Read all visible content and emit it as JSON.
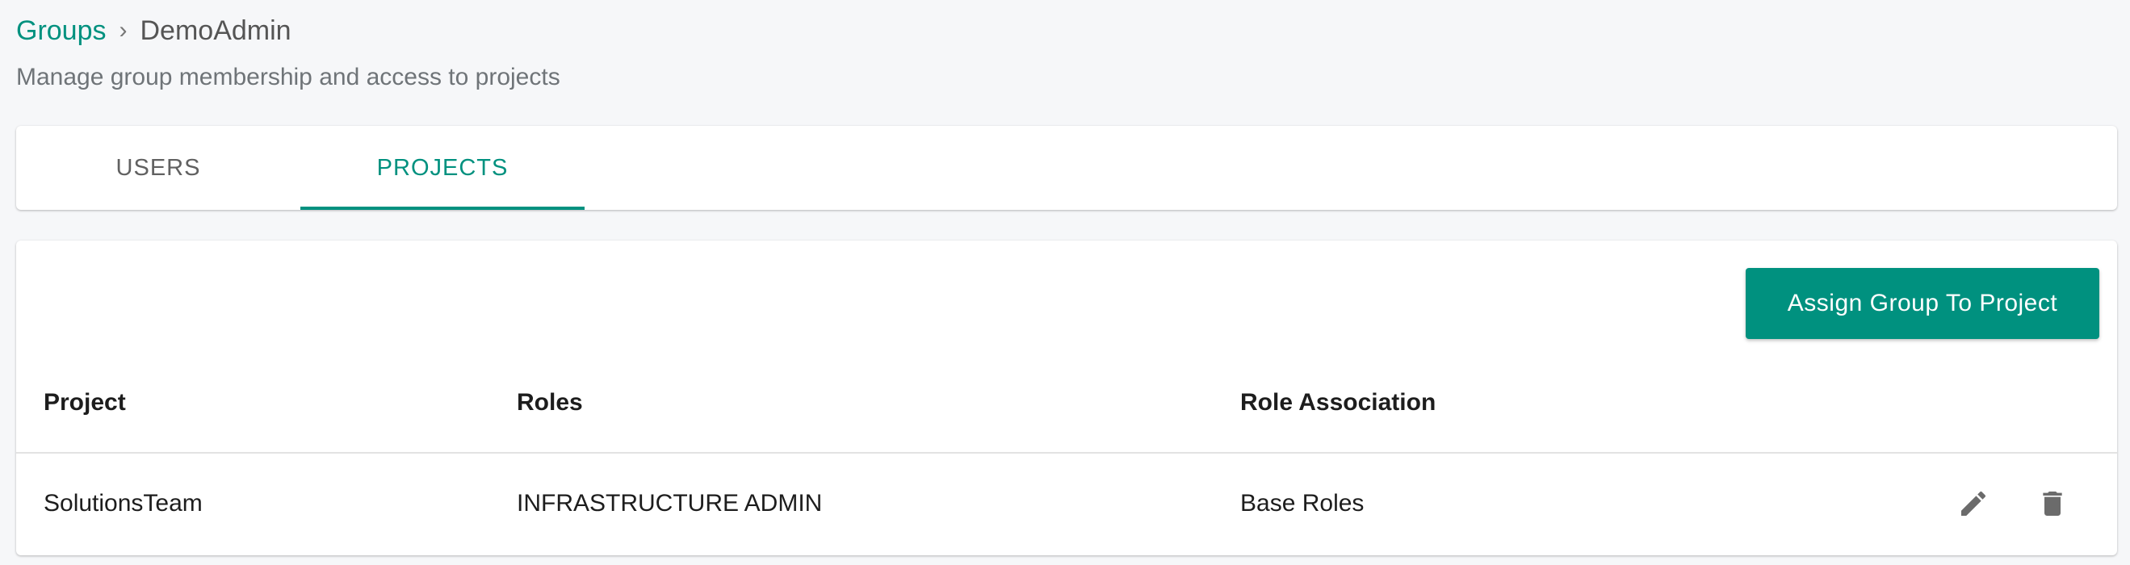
{
  "breadcrumb": {
    "parent": "Groups",
    "separator": "›",
    "current": "DemoAdmin"
  },
  "subtitle": "Manage group membership and access to projects",
  "tabs": [
    {
      "label": "USERS",
      "active": false
    },
    {
      "label": "PROJECTS",
      "active": true
    }
  ],
  "actions": {
    "assign_label": "Assign Group To Project"
  },
  "table": {
    "headers": [
      "Project",
      "Roles",
      "Role Association"
    ],
    "rows": [
      {
        "project": "SolutionsTeam",
        "roles": "INFRASTRUCTURE ADMIN",
        "role_association": "Base Roles",
        "icons": [
          "edit-icon",
          "delete-icon"
        ]
      }
    ]
  },
  "colors": {
    "accent": "#00917f",
    "background": "#f6f7f9",
    "card": "#ffffff",
    "icon": "#6b6b6b"
  }
}
